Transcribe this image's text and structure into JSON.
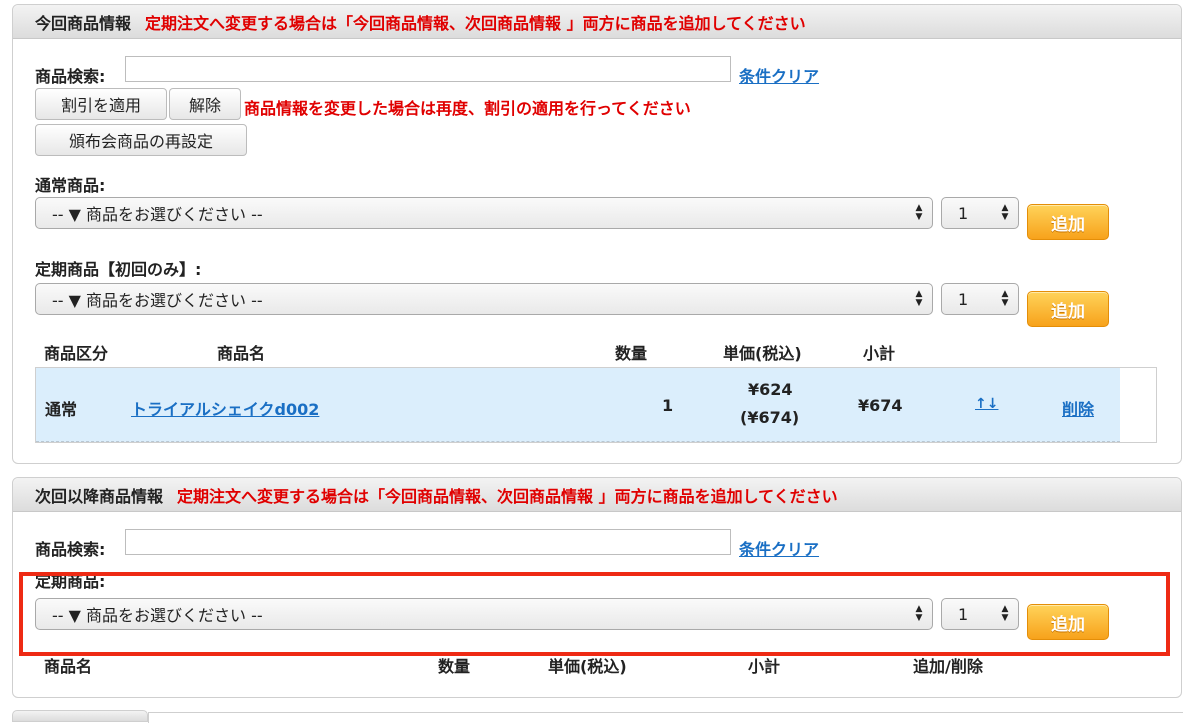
{
  "current": {
    "title": "今回商品情報",
    "note": "定期注文へ変更する場合は「今回商品情報、次回商品情報 」両方に商品を追加してください",
    "search_label": "商品検索:",
    "search_value": "",
    "clear_link": "条件クリア",
    "apply_discount": "割引を適用",
    "cancel_discount": "解除",
    "discount_note": "商品情報を変更した場合は再度、割引の適用を行ってください",
    "reset_button": "頒布会商品の再設定",
    "normal_label": "通常商品:",
    "normal_select": "-- ▼ 商品をお選びください --",
    "normal_qty": "1",
    "add_label": "追加",
    "subs_label": "定期商品【初回のみ】:",
    "subs_select": "-- ▼ 商品をお選びください --",
    "subs_qty": "1",
    "table_headers": {
      "kubun": "商品区分",
      "name": "商品名",
      "qty": "数量",
      "price": "単価(税込)",
      "subtotal": "小計"
    },
    "rows": [
      {
        "kubun": "通常",
        "name": "トライアルシェイクd002",
        "qty": "1",
        "price": "¥624",
        "price_tax": "(¥674)",
        "subtotal": "¥674",
        "move": "↑↓",
        "delete": "削除"
      }
    ]
  },
  "next": {
    "title": "次回以降商品情報",
    "note": "定期注文へ変更する場合は「今回商品情報、次回商品情報 」両方に商品を追加してください",
    "search_label": "商品検索:",
    "search_value": "",
    "clear_link": "条件クリア",
    "subs_label": "定期商品:",
    "subs_select": "-- ▼ 商品をお選びください --",
    "subs_qty": "1",
    "add_label": "追加",
    "table_headers": {
      "name": "商品名",
      "qty": "数量",
      "price": "単価(税込)",
      "subtotal": "小計",
      "action": "追加/削除"
    }
  },
  "colors": {
    "accent_red": "#e00000",
    "link_blue": "#1a6fc4",
    "add_orange": "#f7a21b",
    "row_highlight": "#dbeefc",
    "annotation_box": "#ee2a14"
  }
}
